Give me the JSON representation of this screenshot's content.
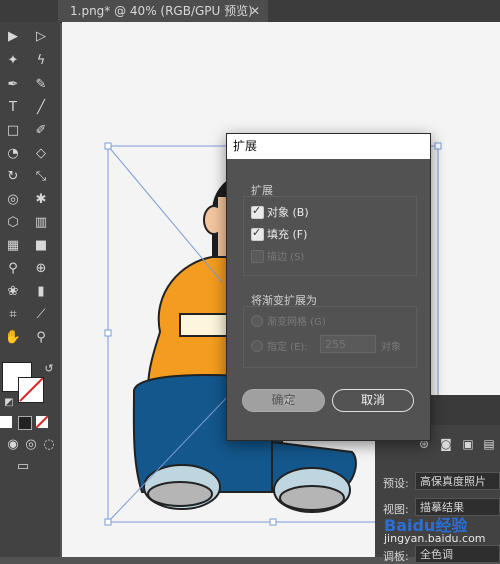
{
  "tab": {
    "title": "1.png* @ 40% (RGB/GPU 预览)",
    "close": "✕"
  },
  "dialog": {
    "title": "扩展",
    "section1": "扩展",
    "opt_object": "对象 (B)",
    "opt_fill": "填充 (F)",
    "opt_stroke": "描边 (S)",
    "section2": "将渐变扩展为",
    "opt_gradient_mesh": "渐变网格 (G)",
    "opt_specify": "指定 (E):",
    "specify_value": "255",
    "specify_unit": "对象",
    "ok": "确定",
    "cancel": "取消"
  },
  "panel": {
    "preset_label": "预设:",
    "preset_value": "高保真度照片",
    "view_label": "视图:",
    "view_value": "描摹结果",
    "mode_label": "调板:",
    "mode_value": "全色调"
  },
  "watermark": {
    "brand": "Baidu经验",
    "url": "jingyan.baidu.com"
  }
}
